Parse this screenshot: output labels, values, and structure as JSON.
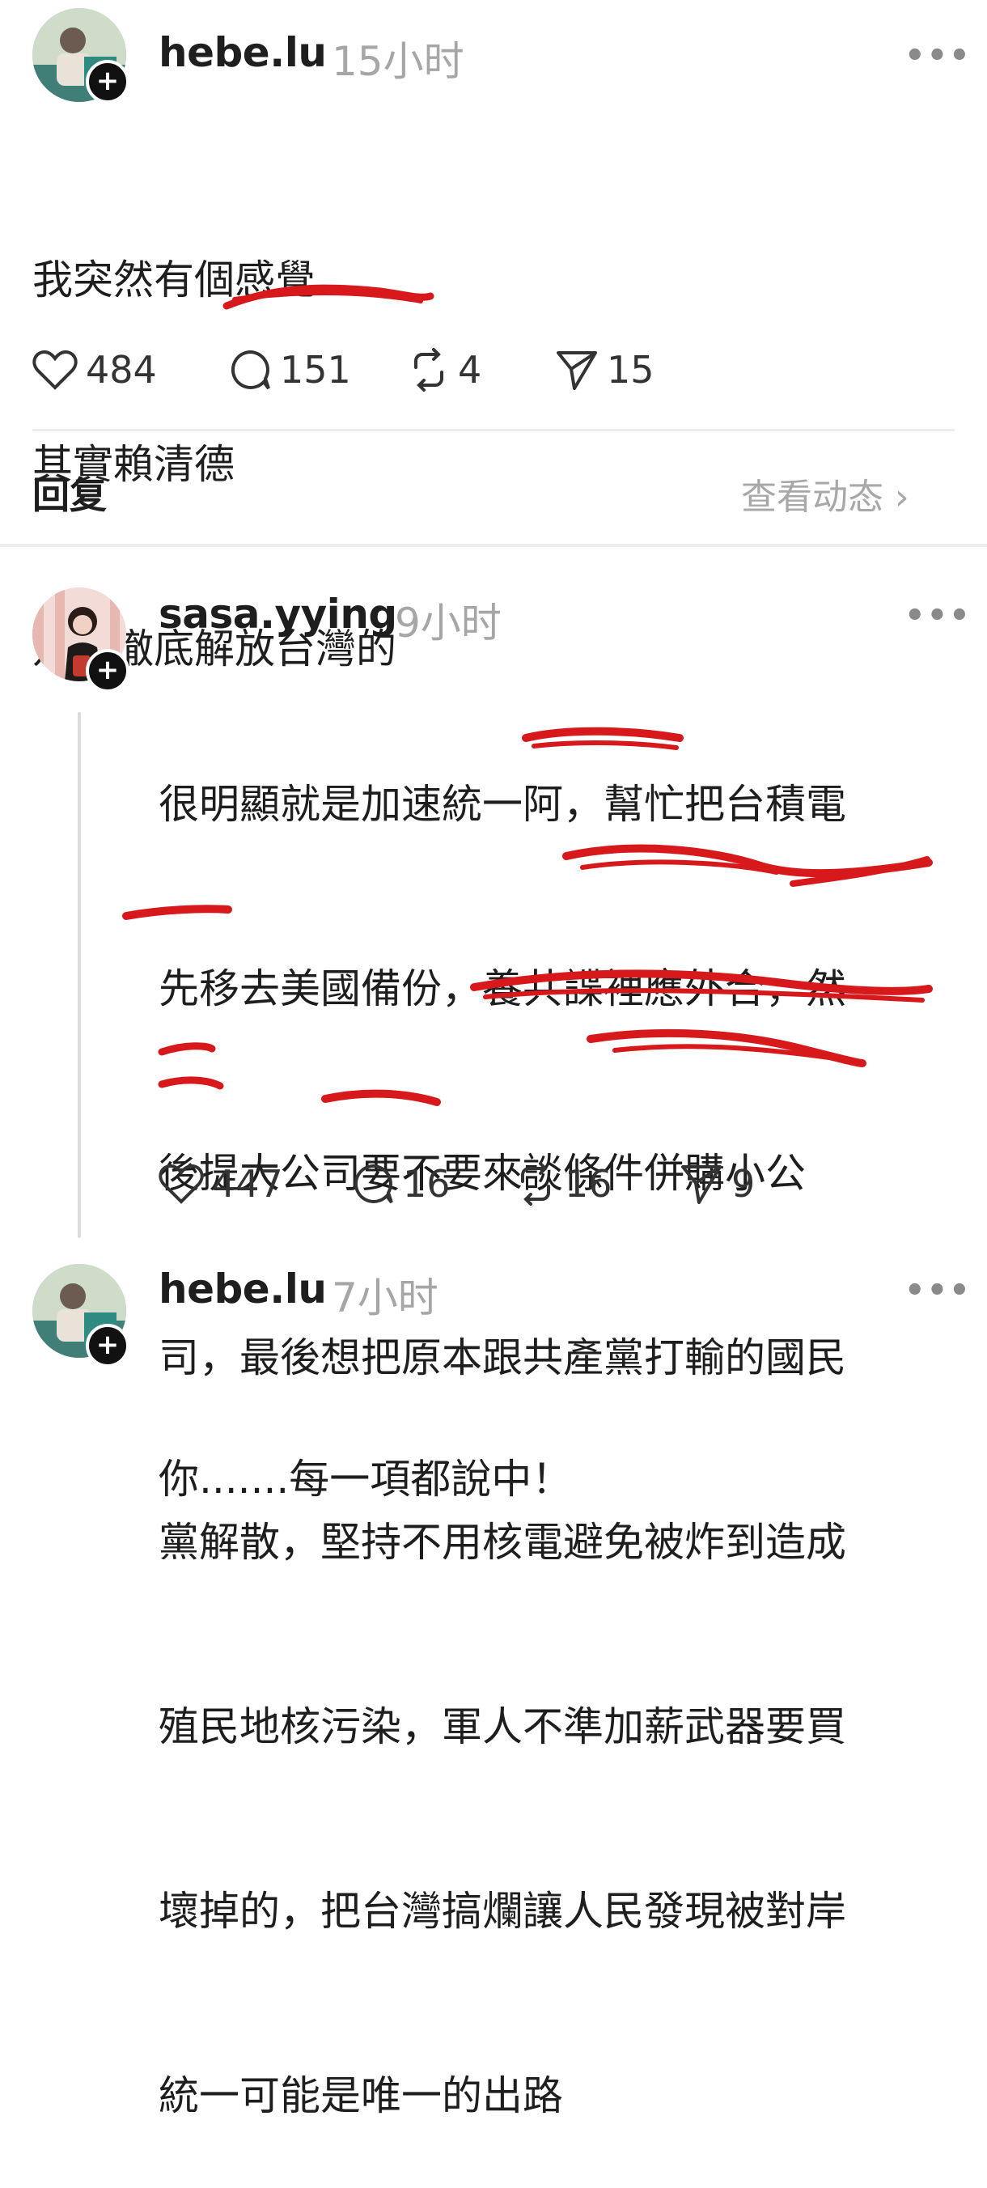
{
  "post": {
    "username": "hebe.lu",
    "time": "15小时",
    "more": "•••",
    "lines": [
      "我突然有個感覺",
      "其實賴清德",
      "是來徹底解放台灣的"
    ],
    "stats": {
      "likes": "484",
      "comments": "151",
      "reposts": "4",
      "shares": "15"
    }
  },
  "reply_bar": {
    "label": "回复",
    "view_activity": "查看动态 ›"
  },
  "comments": [
    {
      "username": "sasa.yying",
      "time": "9小时",
      "more": "•••",
      "lines": [
        "很明顯就是加速統一阿，幫忙把台積電",
        "先移去美國備份，養共諜裡應外合，然",
        "後提大公司要不要來談條件併購小公",
        "司，最後想把原本跟共產黨打輸的國民",
        "黨解散，堅持不用核電避免被炸到造成",
        "殖民地核污染，軍人不準加薪武器要買",
        "壞掉的，把台灣搞爛讓人民發現被對岸",
        "統一可能是唯一的出路"
      ],
      "stats": {
        "likes": "447",
        "comments": "16",
        "reposts": "16",
        "shares": "9"
      }
    },
    {
      "username": "hebe.lu",
      "time": "7小时",
      "more": "•••",
      "lines": [
        "你.......每一項都說中！"
      ]
    }
  ],
  "colors": {
    "redline": "#d7191c",
    "muted": "#a6a6a6",
    "divider": "#ececec"
  }
}
